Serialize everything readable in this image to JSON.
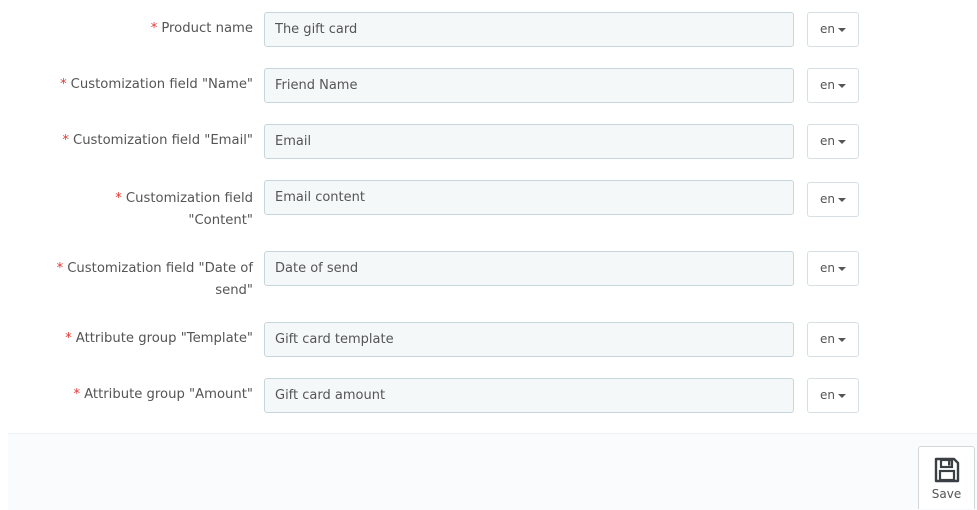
{
  "form": {
    "required_mark": "*",
    "fields": [
      {
        "label": "Product name",
        "value": "The gift card",
        "lang": "en"
      },
      {
        "label": "Customization field \"Name\"",
        "value": "Friend Name",
        "lang": "en"
      },
      {
        "label": "Customization field \"Email\"",
        "value": "Email",
        "lang": "en"
      },
      {
        "label": "Customization field \"Content\"",
        "value": "Email content",
        "lang": "en"
      },
      {
        "label": "Customization field \"Date of send\"",
        "value": "Date of send",
        "lang": "en"
      },
      {
        "label": "Attribute group \"Template\"",
        "value": "Gift card template",
        "lang": "en"
      },
      {
        "label": "Attribute group \"Amount\"",
        "value": "Gift card amount",
        "lang": "en"
      }
    ]
  },
  "footer": {
    "save_label": "Save",
    "save_icon": "floppy-disk-icon"
  }
}
